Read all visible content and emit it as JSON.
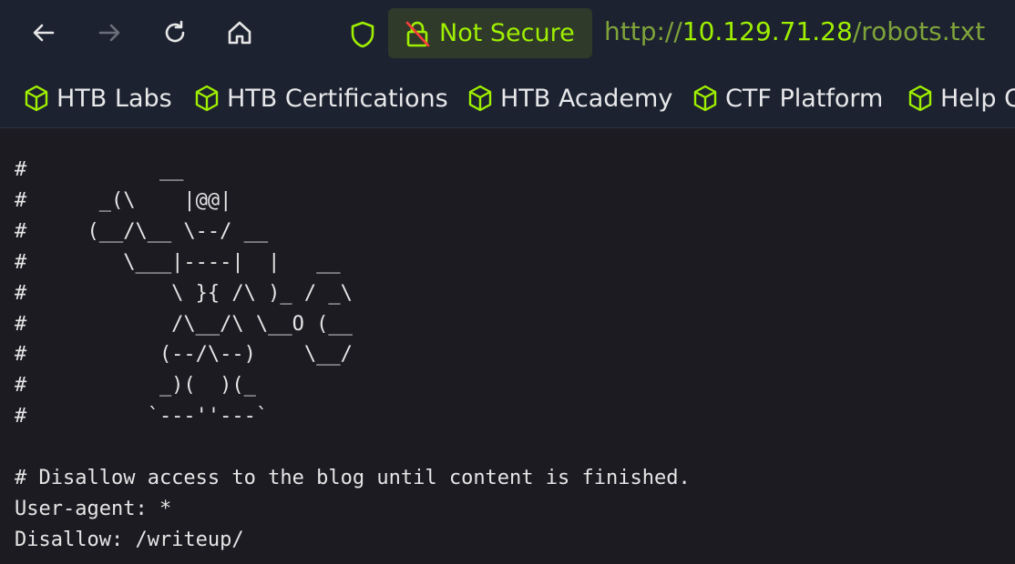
{
  "browser": {
    "nav": {
      "back_icon": "arrow-left-icon",
      "forward_icon": "arrow-right-icon",
      "reload_icon": "reload-icon",
      "home_icon": "home-icon"
    },
    "security": {
      "shield_icon": "shield-icon",
      "lock_icon": "lock-slash-icon",
      "label": "Not Secure"
    },
    "url": {
      "scheme": "http://",
      "host": "10.129.71.28",
      "path": "/robots.txt"
    },
    "bookmarks": [
      {
        "label": "HTB Labs",
        "icon": "cube-icon"
      },
      {
        "label": "HTB Certifications",
        "icon": "cube-icon"
      },
      {
        "label": "HTB Academy",
        "icon": "cube-icon"
      },
      {
        "label": "CTF Platform",
        "icon": "cube-icon"
      },
      {
        "label": "Help Center",
        "icon": "cube-icon"
      }
    ],
    "colors": {
      "accent": "#9fef00",
      "toolbar_bg": "#1c2230",
      "page_bg": "#1c1b22",
      "text": "#e6e6e6"
    }
  },
  "page": {
    "robots_text": "#           __\n#      _(\\    |@@|\n#     (__/\\__ \\--/ __\n#        \\___|----|  |   __\n#            \\ }{ /\\ )_ / _\\\n#            /\\__/\\ \\__O (__\n#           (--/\\--)    \\__/\n#           _)(  )(_\n#          `---''---`\n\n# Disallow access to the blog until content is finished.\nUser-agent: *\nDisallow: /writeup/"
  }
}
